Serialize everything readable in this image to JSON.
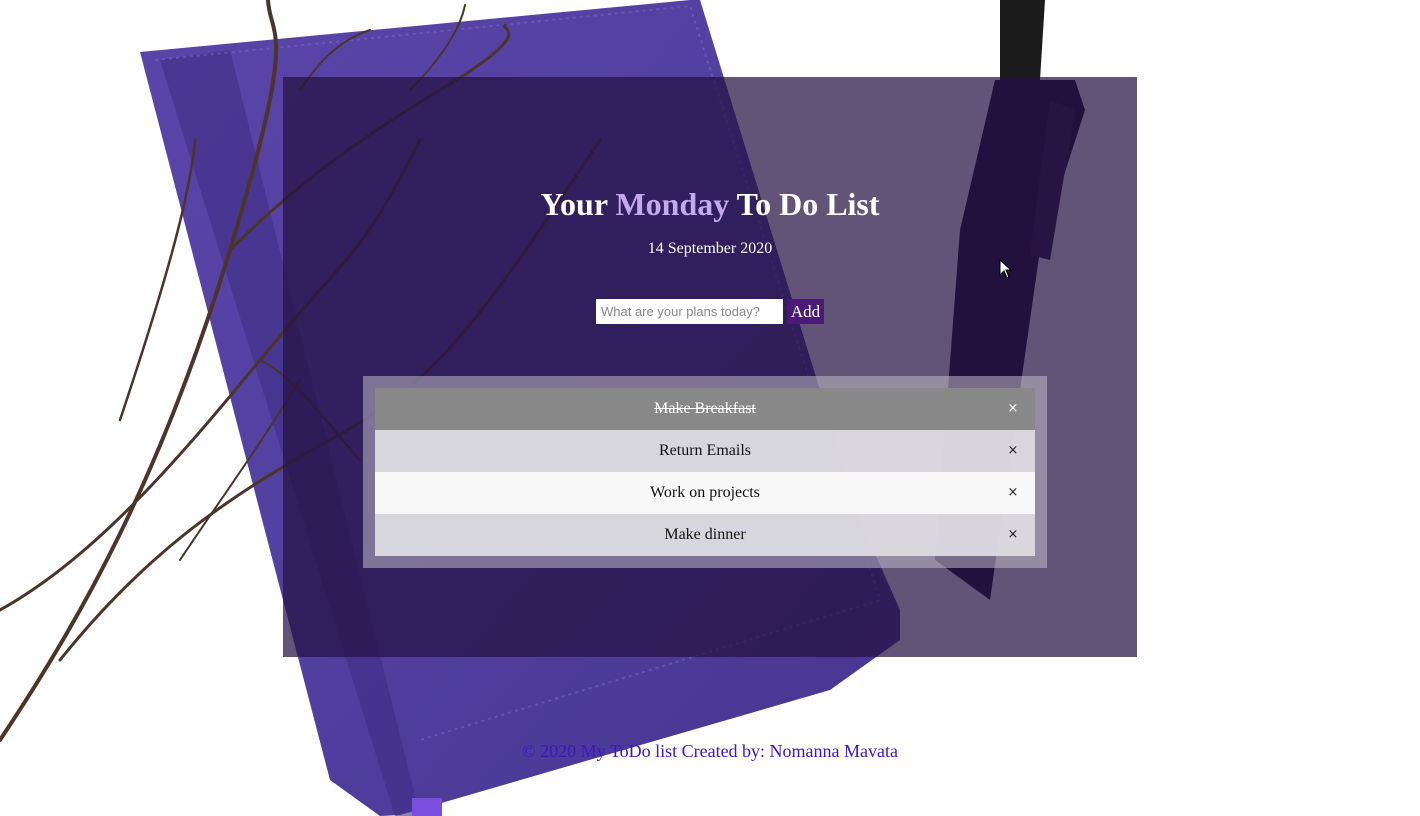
{
  "header": {
    "title_prefix": "Your",
    "title_day": "Monday",
    "title_suffix": "To Do List",
    "date": "14 September 2020"
  },
  "form": {
    "placeholder": "What are your plans today?",
    "value": "",
    "add_label": "Add"
  },
  "todos": [
    {
      "text": "Make Breakfast",
      "checked": true,
      "close": "×"
    },
    {
      "text": "Return Emails",
      "checked": false,
      "close": "×"
    },
    {
      "text": "Work on projects",
      "checked": false,
      "close": "×"
    },
    {
      "text": "Make dinner",
      "checked": false,
      "close": "×"
    }
  ],
  "footer": {
    "text": "© 2020 My ToDo list Created by: Nomanna Mavata"
  },
  "icons": {
    "close": "close-icon",
    "cursor": "mouse-cursor-icon"
  },
  "colors": {
    "card_overlay": "#261242",
    "accent_day": "#c4a9ee",
    "add_button": "#4b1a78",
    "checked_row": "#888888",
    "footer_text": "#3f14c8"
  }
}
